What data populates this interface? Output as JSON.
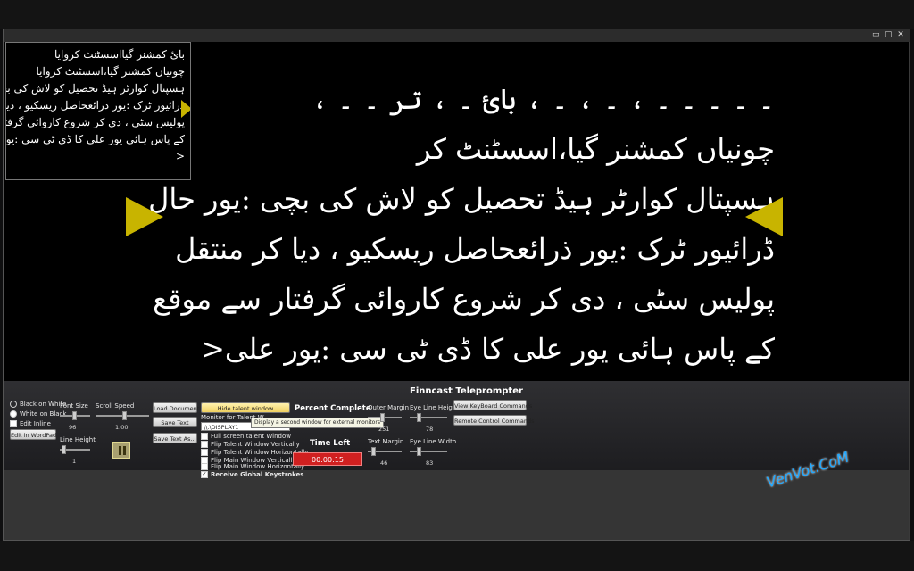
{
  "window": {
    "controls": [
      "▭",
      "▢",
      "✕"
    ]
  },
  "urdu_lines": [
    "۔ ۔ ۔ ۔ ۔ ، ۔ ، ۔ ، بائ ۔ ، تر ۔ ۔ ،",
    "چونیاں کمشنر گیا،اسسٹنٹ کر",
    "ہسپتال کوارٹر ہیڈ تحصیل کو لاش کی بچی :یور حال",
    "ڈرائیور ٹرک :یور ذرائعحاصل ریسکیو ، دیا کر منتقل",
    "پولیس سٹی ، دی کر شروع کاروائی گرفتار سے موقع",
    "کے پاس ہائی یور علی کا ڈی ٹی سی :یور علی<"
  ],
  "mini_lines": [
    "بائ کمشنر گیااسسٹنٹ کروایا",
    "چونیاں کمشنر گیا،اسسٹنٹ کروایا",
    "ہسپتال کوارٹر ہیڈ تحصیل کو لاش کی بچی :یور حال",
    "ڈرائیور ٹرک :یور ذرائعحاصل ریسکیو ، دیا کر منتقل",
    "پولیس سٹی ، دی کر شروع کاروائی گرفتار سے موقع",
    "کے پاس ہائی یور علی کا ڈی ٹی سی :یور علی",
    "<"
  ],
  "controls": {
    "radio_black_on_white": "Black on White",
    "radio_white_on_black": "White on Black",
    "check_edit_inline": "Edit Inline",
    "edit_in_wordpad": "Edit in WordPad",
    "font_size_label": "Font Size",
    "font_size_value": "96",
    "scroll_speed_label": "Scroll Speed",
    "scroll_speed_value": "1.00",
    "line_height_label": "Line Height",
    "line_height_value": "1",
    "load_document": "Load Document",
    "save_text": "Save Text",
    "save_text_as": "Save Text As...",
    "hide_talent_window": "Hide talent window",
    "monitor_label": "Monitor for Talent W",
    "monitor_value": "\\\\.\\DISPLAY1",
    "tooltip": "Display a second window for external monitors",
    "full_screen": "Full screen talent Window",
    "flip_talent_v": "Flip Talent Window Vertically",
    "flip_talent_h": "Flip Talent Window Horizontally",
    "flip_main_v": "Flip Main Window Vertically",
    "flip_main_h": "Flip Main Window Horizontally",
    "global_keys": "Receive Global Keystrokes",
    "percent_complete": "Percent Complete",
    "time_left_label": "Time Left",
    "time_left_value": "00:00:15",
    "outer_margin_label": "Outer Margin",
    "outer_margin_value": "251",
    "text_margin_label": "Text Margin",
    "text_margin_value": "46",
    "eye_line_height_label": "Eye Line Height",
    "eye_line_height_value": "78",
    "eye_line_width_label": "Eye Line Width",
    "eye_line_width_value": "83",
    "app_title": "Finncast Teleprompter",
    "view_keyboard": "View KeyBoard Commands",
    "remote_control": "Remote Control Commands"
  },
  "watermark": "VenVot.CoM",
  "colors": {
    "marker": "#c8b400",
    "time_left_bg": "#d02020"
  }
}
